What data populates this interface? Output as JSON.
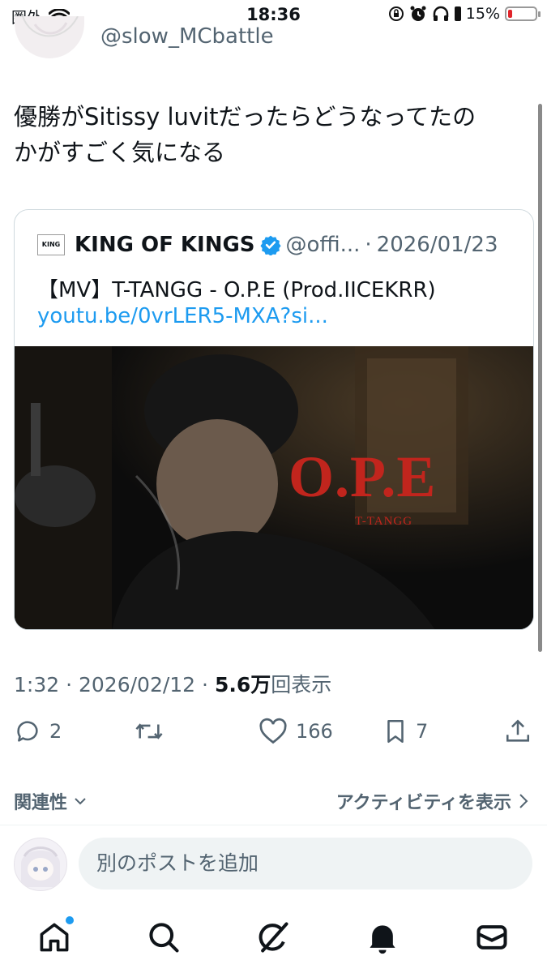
{
  "status_bar": {
    "carrier": "圏外",
    "time": "18:36",
    "battery_percent": "15%",
    "battery_level": 0.15,
    "battery_color": "#e0242a"
  },
  "author": {
    "handle": "@slow_MCbattle"
  },
  "tweet": {
    "text_line1": "優勝がSitissy luvitだったらどうなってたの",
    "text_line2": "かがすごく気になる"
  },
  "quote": {
    "logo_text": "KING",
    "name": "KING OF KINGS",
    "handle": "@offi...",
    "separator": "·",
    "date": "2026/01/23",
    "title": "【MV】T-TANGG - O.P.E (Prod.IICEKRR)",
    "link": "youtu.be/0vrLER5-MXA?si...",
    "video_title": "O.P.E",
    "video_artist": "T-TANGG"
  },
  "meta": {
    "time": "1:32",
    "sep1": "·",
    "date": "2026/02/12",
    "sep2": "·",
    "views": "5.6万",
    "views_label": "回表示"
  },
  "actions": {
    "replies": "2",
    "retweets": "",
    "likes": "166",
    "bookmarks": "7"
  },
  "sort": {
    "left_label": "関連性",
    "right_label": "アクティビティを表示"
  },
  "composer": {
    "placeholder": "別のポストを追加"
  },
  "colors": {
    "accent": "#1d9bf0",
    "text": "#0f1419",
    "muted": "#536471",
    "video_title_red": "#c1251d"
  }
}
